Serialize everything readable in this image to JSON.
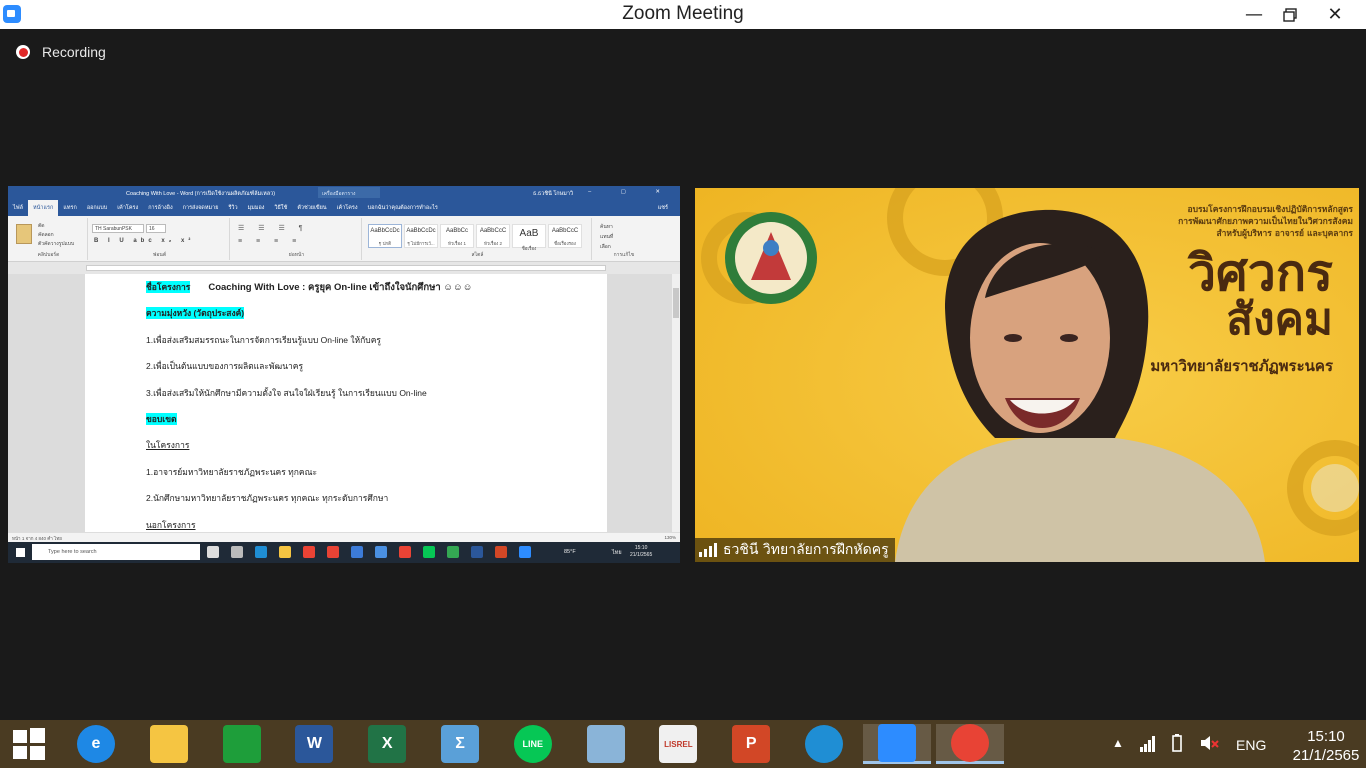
{
  "window": {
    "title": "Zoom Meeting",
    "controls": {
      "minimize": "—",
      "maximize": "❐",
      "close": "✕"
    }
  },
  "recording": {
    "label": "Recording"
  },
  "shared_screen": {
    "word": {
      "title": "Coaching With Love - Word (การเปิดใช้งานผลิตภัณฑ์ล้มเหลว)",
      "search_box": "เครื่องมือตาราง",
      "user": "ธ.ธวชินี โกษมาวิ",
      "tabs": [
        "ไฟล์",
        "หน้าแรก",
        "แทรก",
        "ออกแบบ",
        "เค้าโครง",
        "การอ้างอิง",
        "การส่งจดหมาย",
        "รีวิว",
        "มุมมอง",
        "วิธีใช้",
        "ตัวช่วยเขียน",
        "เค้าโครง",
        "บอกฉันว่าคุณต้องการทำอะไร",
        "แชร์"
      ],
      "ribbon": {
        "clipboard_items": [
          "ตัด",
          "คัดลอก",
          "ตัวคัดวางรูปแบบ"
        ],
        "font_name": "TH SarabunPSK",
        "font_size": "16",
        "groups": [
          "คลิปบอร์ด",
          "ฟอนต์",
          "ย่อหน้า",
          "สไตล์",
          "การแก้ไข"
        ],
        "styles": [
          {
            "sample": "AaBbCcDc",
            "name": "¶ ปกติ"
          },
          {
            "sample": "AaBbCcDc",
            "name": "¶ ไม่มีการเว้..."
          },
          {
            "sample": "AaBbCc",
            "name": "หัวเรื่อง 1"
          },
          {
            "sample": "AaBbCcC",
            "name": "หัวเรื่อง 2"
          },
          {
            "sample": "AaB",
            "name": "ชื่อเรื่อง"
          },
          {
            "sample": "AaBbCcC",
            "name": "ชื่อเรื่องรอง"
          }
        ],
        "editing": [
          "ค้นหา",
          "แทนที่",
          "เลือก"
        ]
      },
      "document_lines": [
        {
          "label": "ชื่อโครงการ",
          "text": "Coaching  With  Love  :  ครูยุค On-line  เข้าถึงใจนักศึกษา  ☺☺☺"
        },
        {
          "label": "ความมุ่งหวัง  (วัตถุประสงค์)",
          "text": ""
        },
        {
          "label": "",
          "text": "1.เพื่อส่งเสริมสมรรถนะในการจัดการเรียนรู้แบบ  On-line  ให้กับครู"
        },
        {
          "label": "",
          "text": "2.เพื่อเป็นต้นแบบของการผลิตและพัฒนาครู"
        },
        {
          "label": "",
          "text": "3.เพื่อส่งเสริมให้นักศึกษามีความตั้งใจ  สนใจใฝ่เรียนรู้  ในการเรียนแบบ On-line"
        },
        {
          "label": "ขอบเขต",
          "text": ""
        },
        {
          "label": "",
          "text": "ในโครงการ"
        },
        {
          "label": "",
          "text": "1.อาจารย์มหาวิทยาลัยราชภัฏพระนคร  ทุกคณะ"
        },
        {
          "label": "",
          "text": "2.นักศึกษามหาวิทยาลัยราชภัฏพระนคร  ทุกคณะ  ทุกระดับการศึกษา"
        },
        {
          "label": "",
          "text": "นอกโครงการ"
        }
      ],
      "status_left": "หน้า 1 จาก 4    840 คำ    ไทย",
      "status_right": "130%",
      "inner_taskbar": {
        "search_placeholder": "Type here to search",
        "weather": "85°F",
        "lang": "ไทย",
        "time": "15:10",
        "date": "21/1/2565"
      }
    }
  },
  "video": {
    "participant_name": "ธวชินี  วิทยาลัยการฝึกหัดครู",
    "background_text": {
      "top_lines": [
        "อบรมโครงการฝึกอบรมเชิงปฏิบัติการหลักสูตร",
        "การพัฒนาศักยภาพความเป็นไทยในวิศวกรสังคม",
        "สำหรับผู้บริหาร อาจารย์ และบุคลากร"
      ],
      "big_1": "วิศวกร",
      "big_2": "สังคม",
      "university": "มหาวิทยาลัยราชภัฏพระนคร"
    }
  },
  "taskbar": {
    "apps": [
      {
        "name": "internet-explorer",
        "glyph": "e",
        "color": "#1e88e5"
      },
      {
        "name": "file-explorer",
        "glyph": "",
        "color": "#f5c542"
      },
      {
        "name": "store",
        "glyph": "",
        "color": "#1e9e3a"
      },
      {
        "name": "word",
        "glyph": "W",
        "color": "#2b579a"
      },
      {
        "name": "excel",
        "glyph": "X",
        "color": "#217346"
      },
      {
        "name": "math-input",
        "glyph": "Σ",
        "color": "#5aa0d8"
      },
      {
        "name": "line",
        "glyph": "LINE",
        "color": "#06c755"
      },
      {
        "name": "paint",
        "glyph": "",
        "color": "#8ab4d8"
      },
      {
        "name": "lisrel",
        "glyph": "LISREL",
        "color": "#f0f0f0"
      },
      {
        "name": "powerpoint",
        "glyph": "P",
        "color": "#d24726"
      },
      {
        "name": "edge",
        "glyph": "",
        "color": "#1f8ed4"
      },
      {
        "name": "zoom",
        "glyph": "",
        "color": "#2d8cff"
      },
      {
        "name": "chrome",
        "glyph": "",
        "color": "#e84335"
      }
    ],
    "tray": {
      "lang": "ENG",
      "time": "15:10",
      "date": "21/1/2565"
    }
  }
}
